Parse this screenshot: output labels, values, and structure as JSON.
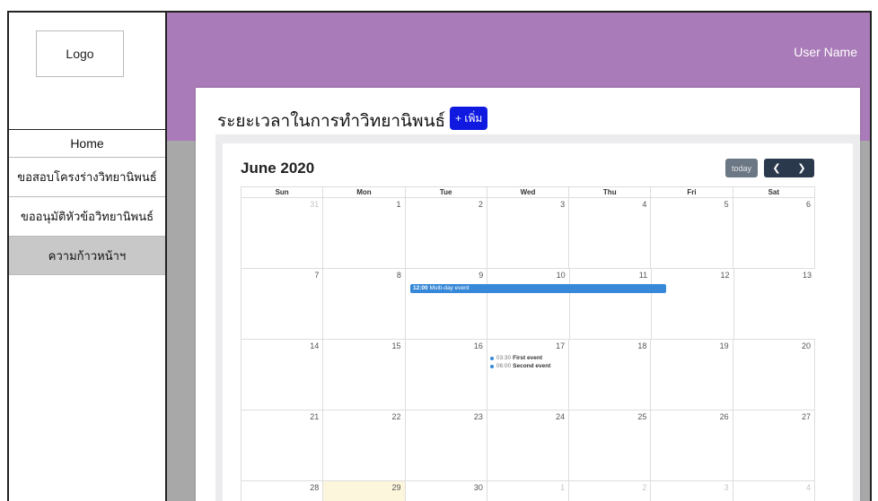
{
  "sidebar": {
    "logo": "Logo",
    "items": [
      {
        "label": "Home"
      },
      {
        "label": "ขอสอบโครงร่างวิทยานิพนธ์"
      },
      {
        "label": "ขออนุมัติหัวข้อวิทยานิพนธ์"
      },
      {
        "label": "ความก้าวหน้าฯ"
      }
    ]
  },
  "header": {
    "user_name": "User Name"
  },
  "main": {
    "title": "ระยะเวลาในการทำวิทยานิพนธ์",
    "add_label": "+ เพิ่ม"
  },
  "calendar": {
    "title": "June 2020",
    "today_label": "today",
    "prev_icon": "chevron-left-icon",
    "next_icon": "chevron-right-icon",
    "days_of_week": [
      "Sun",
      "Mon",
      "Tue",
      "Wed",
      "Thu",
      "Fri",
      "Sat"
    ],
    "weeks": [
      [
        "31",
        "1",
        "2",
        "3",
        "4",
        "5",
        "6"
      ],
      [
        "7",
        "8",
        "9",
        "10",
        "11",
        "12",
        "13"
      ],
      [
        "14",
        "15",
        "16",
        "17",
        "18",
        "19",
        "20"
      ],
      [
        "21",
        "22",
        "23",
        "24",
        "25",
        "26",
        "27"
      ],
      [
        "28",
        "29",
        "30",
        "1",
        "2",
        "3",
        "4"
      ]
    ],
    "events": {
      "multi": {
        "time": "12:00",
        "title": "Multi-day event"
      },
      "first": {
        "time": "03:30",
        "title": "First event"
      },
      "second": {
        "time": "06:00",
        "title": "Second event"
      }
    },
    "colors": {
      "event": "#3788d8",
      "today_highlight": "#fcf6dc"
    }
  },
  "colors": {
    "header": "#a97bb8",
    "content_bg": "#a8a8a8",
    "add_button": "#1019e0"
  }
}
